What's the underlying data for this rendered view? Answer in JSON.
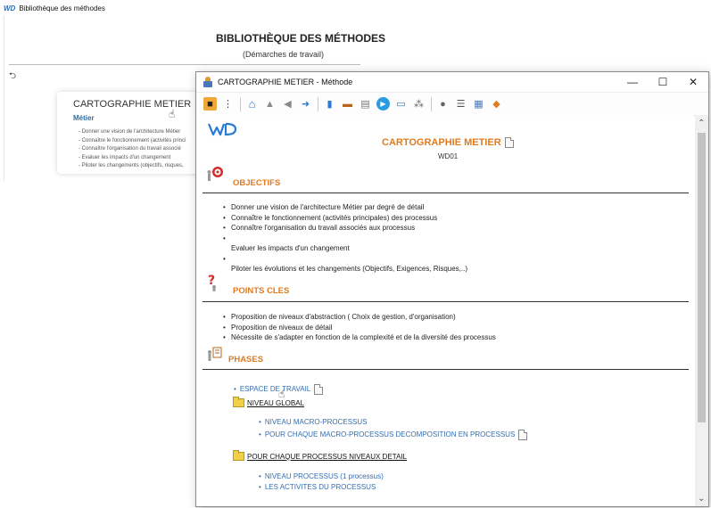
{
  "background_window": {
    "title": "Bibliothèque des méthodes",
    "logo_text": "WD",
    "heading": "BIBLIOTHÈQUE DES MÉTHODES",
    "subheading": "(Démarches de travail)",
    "card": {
      "title": "CARTOGRAPHIE METIER",
      "subtitle": "Métier",
      "items": [
        "Donner une vision de l'architecture Métier",
        "Connaître le fonctionnement (activités princi",
        "Connaître l'organisation du travail associé",
        "Evaluer les impacts d'un changement",
        "Piloter les changements (objectifs, risques,"
      ]
    }
  },
  "main_window": {
    "title": "CARTOGRAPHIE METIER - Méthode",
    "controls": {
      "minimize": "—",
      "maximize": "☐",
      "close": "✕"
    },
    "toolbar_icons": [
      "open-folder-icon",
      "tree-icon",
      "home-icon",
      "up-arrow-icon",
      "back-arrow-icon",
      "forward-arrow-icon",
      "attachment-icon",
      "briefcase-icon",
      "document-icon",
      "play-icon",
      "card-icon",
      "users-icon",
      "globe-icon",
      "notes-icon",
      "print-icon",
      "export-icon"
    ],
    "document": {
      "title": "CARTOGRAPHIE METIER",
      "code": "WD01",
      "sections": {
        "objectifs": {
          "title": "OBJECTIFS",
          "items": [
            "Donner une vision de l'architecture Métier par degré de détail",
            "Connaître le fonctionnement (activités principales) des processus",
            "Connaître l'organisation du travail associés aux  processus",
            "",
            "Evaluer les impacts d'un changement",
            "",
            "Piloter les évolutions et les changements (Objectifs, Exigences, Risques,..)"
          ]
        },
        "points_cles": {
          "title": "POINTS CLES",
          "items": [
            "Proposition de niveaux d'abstraction ( Choix de gestion, d'organisation)",
            "Proposition de niveaux de détail",
            "Nécessite de s'adapter en fonction de la complexité et de la diversité des processus"
          ]
        },
        "phases": {
          "title": "PHASES",
          "espace": "ESPACE DE TRAVAIL",
          "niveau_global": "NIVEAU GLOBAL",
          "global_items": [
            "NIVEAU MACRO-PROCESSUS",
            "POUR CHAQUE MACRO-PROCESSUS DECOMPOSITION EN PROCESSUS"
          ],
          "processus_detail": "POUR CHAQUE PROCESSUS NIVEAUX DETAIL",
          "detail_items": [
            "NIVEAU PROCESSUS (1 processus)",
            "LES ACTIVITES DU PROCESSUS"
          ]
        }
      }
    }
  }
}
